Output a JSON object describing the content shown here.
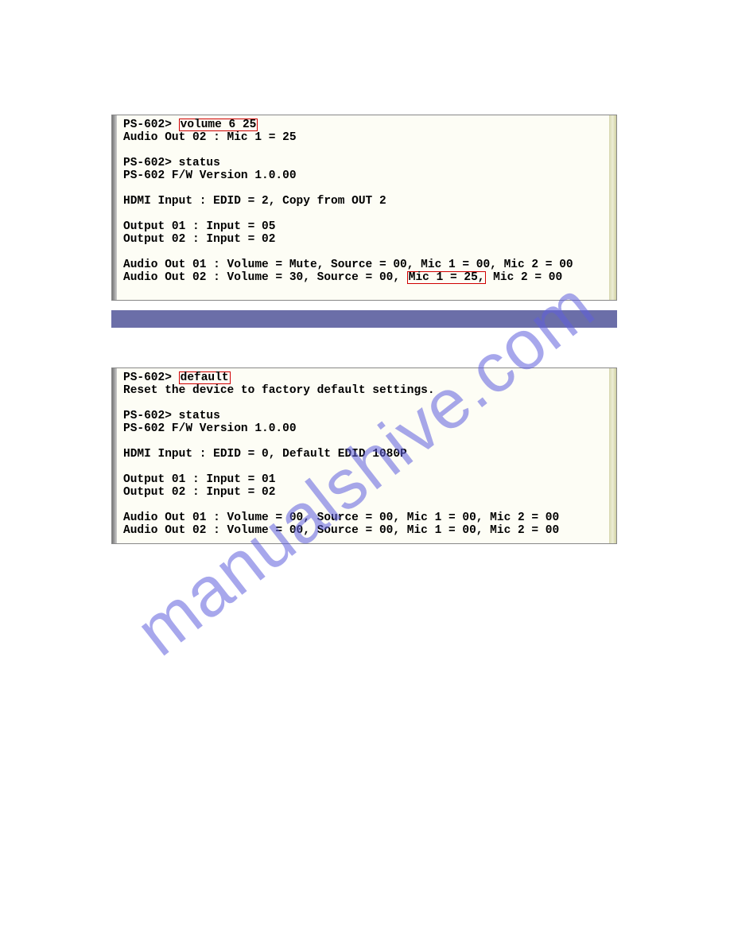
{
  "watermark": "manualshive.com",
  "terminal1": {
    "lines": [
      {
        "segments": [
          {
            "t": "PS-602> "
          },
          {
            "t": "volume 6 25",
            "hl": true
          }
        ]
      },
      {
        "segments": [
          {
            "t": "Audio Out 02 : Mic 1 = 25"
          }
        ]
      },
      {
        "segments": [
          {
            "t": ""
          }
        ]
      },
      {
        "segments": [
          {
            "t": "PS-602> status"
          }
        ]
      },
      {
        "segments": [
          {
            "t": "PS-602 F/W Version 1.0.00"
          }
        ]
      },
      {
        "segments": [
          {
            "t": ""
          }
        ]
      },
      {
        "segments": [
          {
            "t": "HDMI Input : EDID = 2, Copy from OUT 2"
          }
        ]
      },
      {
        "segments": [
          {
            "t": ""
          }
        ]
      },
      {
        "segments": [
          {
            "t": "Output 01 : Input = 05"
          }
        ]
      },
      {
        "segments": [
          {
            "t": "Output 02 : Input = 02"
          }
        ]
      },
      {
        "segments": [
          {
            "t": ""
          }
        ]
      },
      {
        "segments": [
          {
            "t": "Audio Out 01 : Volume = Mute, Source = 00, Mic 1 = 00, Mic 2 = 00"
          }
        ]
      },
      {
        "segments": [
          {
            "t": "Audio Out 02 : Volume = 30, Source = 00, "
          },
          {
            "t": "Mic 1 = 25,",
            "hl": true
          },
          {
            "t": " Mic 2 = 00"
          }
        ]
      }
    ]
  },
  "terminal2": {
    "lines": [
      {
        "segments": [
          {
            "t": "PS-602> "
          },
          {
            "t": "default",
            "hl": true
          }
        ]
      },
      {
        "segments": [
          {
            "t": "Reset the device to factory default settings."
          }
        ]
      },
      {
        "segments": [
          {
            "t": ""
          }
        ]
      },
      {
        "segments": [
          {
            "t": "PS-602> status"
          }
        ]
      },
      {
        "segments": [
          {
            "t": "PS-602 F/W Version 1.0.00"
          }
        ]
      },
      {
        "segments": [
          {
            "t": ""
          }
        ]
      },
      {
        "segments": [
          {
            "t": "HDMI Input : EDID = 0, Default EDID 1080P"
          }
        ]
      },
      {
        "segments": [
          {
            "t": ""
          }
        ]
      },
      {
        "segments": [
          {
            "t": "Output 01 : Input = 01"
          }
        ]
      },
      {
        "segments": [
          {
            "t": "Output 02 : Input = 02"
          }
        ]
      },
      {
        "segments": [
          {
            "t": ""
          }
        ]
      },
      {
        "segments": [
          {
            "t": "Audio Out 01 : Volume = 00, Source = 00, Mic 1 = 00, Mic 2 = 00"
          }
        ]
      },
      {
        "segments": [
          {
            "t": "Audio Out 02 : Volume = 00, Source = 00, Mic 1 = 00, Mic 2 = 00"
          }
        ]
      }
    ]
  }
}
